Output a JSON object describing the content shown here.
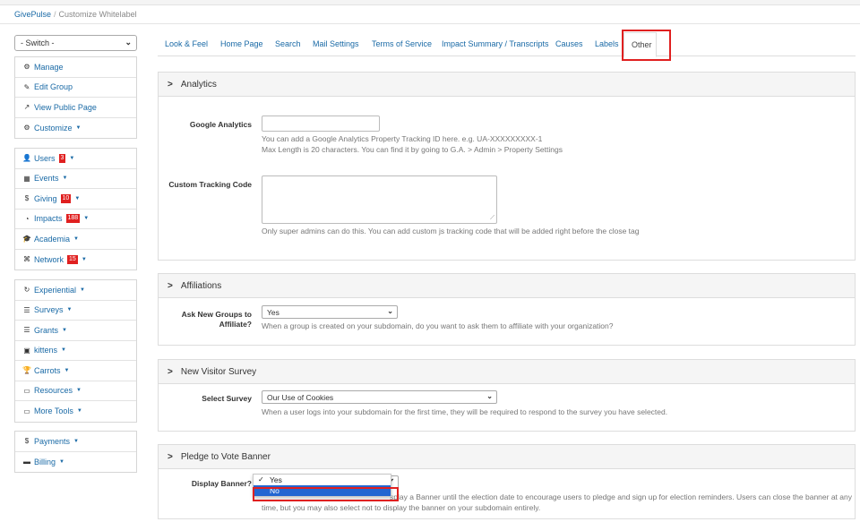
{
  "breadcrumb": {
    "home": "GivePulse",
    "sep": "/",
    "current": "Customize Whitelabel"
  },
  "sidebar": {
    "switch_value": "- Switch -",
    "group1": [
      {
        "label": "Manage",
        "icon": "cogs-icon"
      },
      {
        "label": "Edit Group",
        "icon": "pencil-icon"
      },
      {
        "label": "View Public Page",
        "icon": "external-link-icon"
      },
      {
        "label": "Customize",
        "icon": "cogs-icon",
        "caret": true
      }
    ],
    "group2": [
      {
        "label": "Users",
        "icon": "user-icon",
        "badge": "3",
        "caret": true
      },
      {
        "label": "Events",
        "icon": "calendar-icon",
        "caret": true
      },
      {
        "label": "Giving",
        "icon": "dollar-icon",
        "badge": "10",
        "caret": true
      },
      {
        "label": "Impacts",
        "icon": "dashboard-icon",
        "badge": "188",
        "caret": true
      },
      {
        "label": "Academia",
        "icon": "graduation-cap-icon",
        "caret": true
      },
      {
        "label": "Network",
        "icon": "sitemap-icon",
        "badge": "15",
        "caret": true
      }
    ],
    "group3": [
      {
        "label": "Experiential",
        "icon": "refresh-icon",
        "caret": true
      },
      {
        "label": "Surveys",
        "icon": "list-icon",
        "caret": true
      },
      {
        "label": "Grants",
        "icon": "list-icon",
        "caret": true
      },
      {
        "label": "kittens",
        "icon": "briefcase-icon",
        "caret": true
      },
      {
        "label": "Carrots",
        "icon": "trophy-icon",
        "caret": true
      },
      {
        "label": "Resources",
        "icon": "folder-icon",
        "caret": true
      },
      {
        "label": "More Tools",
        "icon": "folder-icon",
        "caret": true
      }
    ],
    "group4": [
      {
        "label": "Payments",
        "icon": "dollar-icon",
        "caret": true
      },
      {
        "label": "Billing",
        "icon": "credit-card-icon",
        "caret": true
      }
    ]
  },
  "tabs": [
    "Look & Feel",
    "Home Page",
    "Search",
    "Mail Settings",
    "Terms of Service",
    "Impact Summary / Transcripts",
    "Causes",
    "Labels",
    "Other"
  ],
  "analytics": {
    "title": "Analytics",
    "ga_label": "Google Analytics",
    "ga_value": "",
    "ga_help1": "You can add a Google Analytics Property Tracking ID here. e.g. UA-XXXXXXXXX-1",
    "ga_help2": "Max Length is 20 characters. You can find it by going to G.A. > Admin > Property Settings",
    "ct_label": "Custom Tracking Code",
    "ct_help": "Only super admins can do this. You can add custom js tracking code that will be added right before the close tag"
  },
  "affiliations": {
    "title": "Affiliations",
    "label1": "Ask New Groups to",
    "label2": "Affiliate?",
    "value": "Yes",
    "help": "When a group is created on your subdomain, do you want to ask them to affiliate with your organization?"
  },
  "survey": {
    "title": "New Visitor Survey",
    "label": "Select Survey",
    "value": "Our Use of Cookies",
    "help": "When a user logs into your subdomain for the first time, they will be required to respond to the survey you have selected."
  },
  "pledge": {
    "title": "Pledge to Vote Banner",
    "label": "Display Banner?",
    "help1": "splay a Banner until the election date to encourage users to pledge and sign up for election reminders. Users can close the banner at any",
    "help2": "time, but you may also select not to display the banner on your subdomain entirely.",
    "options": [
      "Yes",
      "No"
    ],
    "checked": "✓",
    "highlighted": "No"
  },
  "colors": {
    "link": "#1a6aa6",
    "badge": "#e02020",
    "annotation": "#e02020",
    "highlight": "#2366d1"
  }
}
